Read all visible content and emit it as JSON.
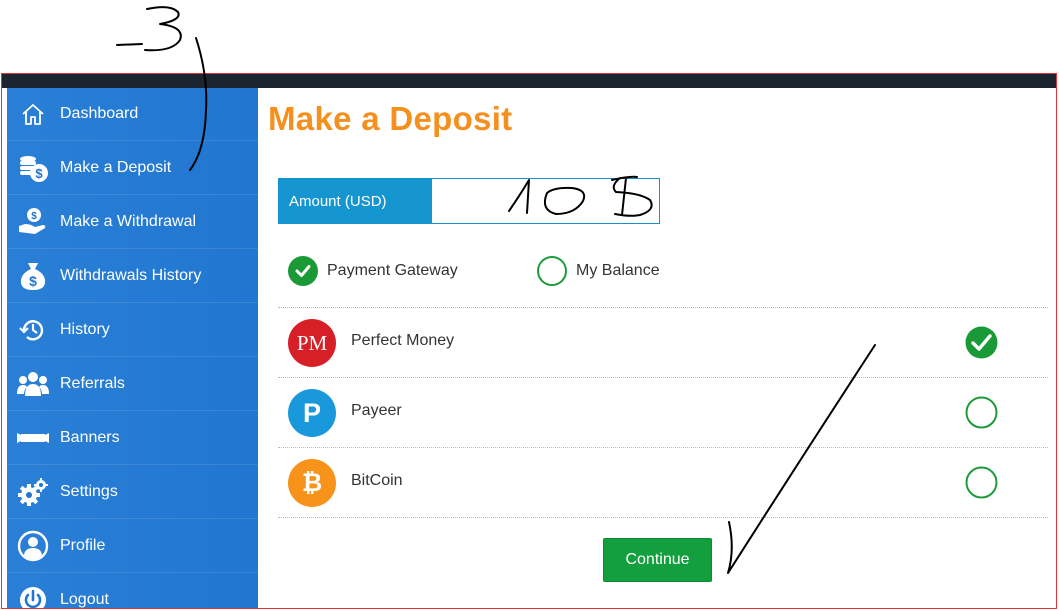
{
  "sidebar": {
    "items": [
      {
        "label": "Dashboard",
        "icon": "home-icon"
      },
      {
        "label": "Make a Deposit",
        "icon": "coins-deposit-icon"
      },
      {
        "label": "Make a Withdrawal",
        "icon": "hand-coin-icon"
      },
      {
        "label": "Withdrawals History",
        "icon": "money-bag-icon"
      },
      {
        "label": "History",
        "icon": "history-clock-icon"
      },
      {
        "label": "Referrals",
        "icon": "users-group-icon"
      },
      {
        "label": "Banners",
        "icon": "banner-icon"
      },
      {
        "label": "Settings",
        "icon": "gears-icon"
      },
      {
        "label": "Profile",
        "icon": "user-profile-icon"
      },
      {
        "label": "Logout",
        "icon": "power-icon"
      }
    ]
  },
  "main": {
    "title": "Make a Deposit",
    "amount": {
      "label": "Amount (USD)",
      "value": ""
    },
    "source_options": [
      {
        "label": "Payment Gateway",
        "selected": true
      },
      {
        "label": "My Balance",
        "selected": false
      }
    ],
    "gateways": [
      {
        "name": "Perfect Money",
        "logo_text": "PM",
        "selected": true,
        "color": "#d61f26"
      },
      {
        "name": "Payeer",
        "logo_text": "P",
        "selected": false,
        "color": "#1a98dc"
      },
      {
        "name": "BitCoin",
        "logo_text": "₿",
        "selected": false,
        "color": "#f7931a"
      }
    ],
    "continue_label": "Continue"
  },
  "annotations": {
    "top_scribble": "-3",
    "amount_scribble": "10 $"
  },
  "colors": {
    "accent": "#f5901e",
    "sidebar": "#2176d0",
    "amount_label": "#1696d0",
    "success": "#139f3e"
  }
}
